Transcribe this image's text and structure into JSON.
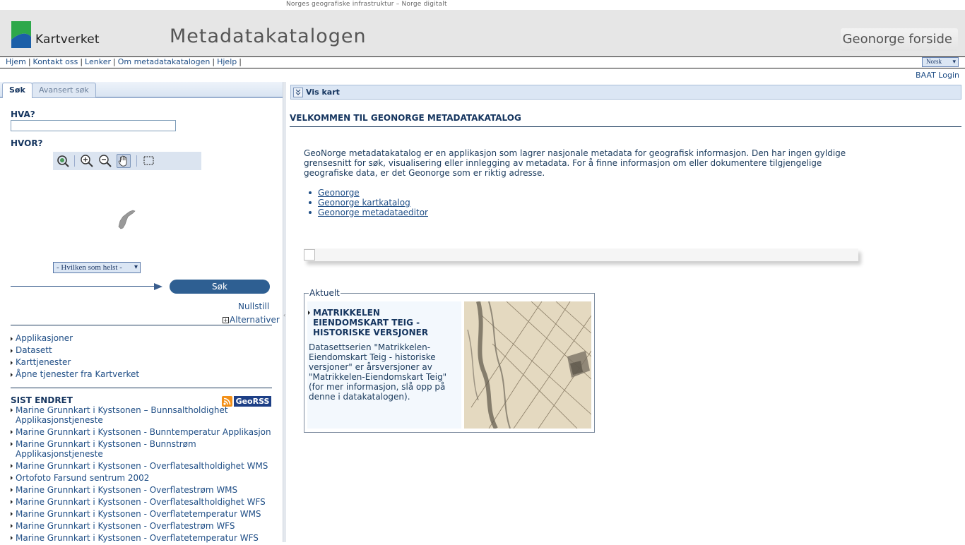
{
  "topstrip": {
    "text": "Norges geografiske infrastruktur – Norge digitalt"
  },
  "header": {
    "logo_text": "Kartverket",
    "title": "Metadatakatalogen",
    "geonorge_button": "Geonorge forside"
  },
  "nav": {
    "links": [
      "Hjem",
      "Kontakt oss",
      "Lenker",
      "Om metadatakatalogen",
      "Hjelp"
    ],
    "language": "Norsk"
  },
  "baat_login": "BAAT Login",
  "left": {
    "tabs": [
      "Søk",
      "Avansert søk"
    ],
    "hva_label": "HVA?",
    "hva_value": "",
    "hvor_label": "HVOR?",
    "map_tools": [
      "zoom-extent-icon",
      "zoom-in-icon",
      "zoom-out-icon",
      "pan-hand-icon",
      "select-rectangle-icon"
    ],
    "region_select": "- Hvilken som helst -",
    "search_button": "Søk",
    "reset_link": "Nullstill",
    "alternatives_link": "Alternativer",
    "categories": [
      "Applikasjoner",
      "Datasett",
      "Karttjenester",
      "Åpne tjenester fra Kartverket"
    ],
    "recent_heading": "SIST ENDRET",
    "georss_label": "GeoRSS",
    "recent": [
      "Marine Grunnkart i Kystsonen – Bunnsaltholdighet Applikasjonstjeneste",
      "Marine Grunnkart i Kystsonen - Bunntemperatur Applikasjon",
      "Marine Grunnkart i Kystsonen - Bunnstrøm Applikasjonstjeneste",
      "Marine Grunnkart i Kystsonen - Overflatesaltholdighet WMS",
      "Ortofoto Farsund sentrum 2002",
      "Marine Grunnkart i Kystsonen - Overflatestrøm WMS",
      "Marine Grunnkart i Kystsonen - Overflatesaltholdighet WFS",
      "Marine Grunnkart i Kystsonen - Overflatetemperatur WMS",
      "Marine Grunnkart i Kystsonen - Overflatestrøm WFS",
      "Marine Grunnkart i Kystsonen - Overflatetemperatur WFS"
    ]
  },
  "right": {
    "vis_kart": "Vis kart",
    "welcome_title": "VELKOMMEN TIL GEONORGE METADATAKATALOG",
    "intro": "GeoNorge metadatakatalog er en applikasjon som lagrer nasjonale metadata for geografisk informasjon. Den har ingen gyldige grensesnitt for søk, visualisering eller innlegging av metadata. For å finne informasjon om eller dokumentere tilgjengelige geografiske data, er det Geonorge som er riktig adresse.",
    "links": [
      "Geonorge",
      "Geonorge kartkatalog",
      "Geonorge metadataeditor"
    ],
    "aktuelt": {
      "legend": "Aktuelt",
      "title": "MATRIKKELEN EIENDOMSKART TEIG - HISTORISKE VERSJONER",
      "description": "Datasettserien \"Matrikkelen-Eiendomskart Teig - historiske versjoner\" er årsversjoner av \"Matrikkelen-Eiendomskart Teig\" (for mer informasjon, slå opp på denne i datakatalogen)."
    }
  },
  "colors": {
    "brand_blue": "#2e5f92",
    "logo_green": "#2da84a",
    "logo_blue": "#1b5fa8",
    "rss_orange": "#f39018"
  }
}
